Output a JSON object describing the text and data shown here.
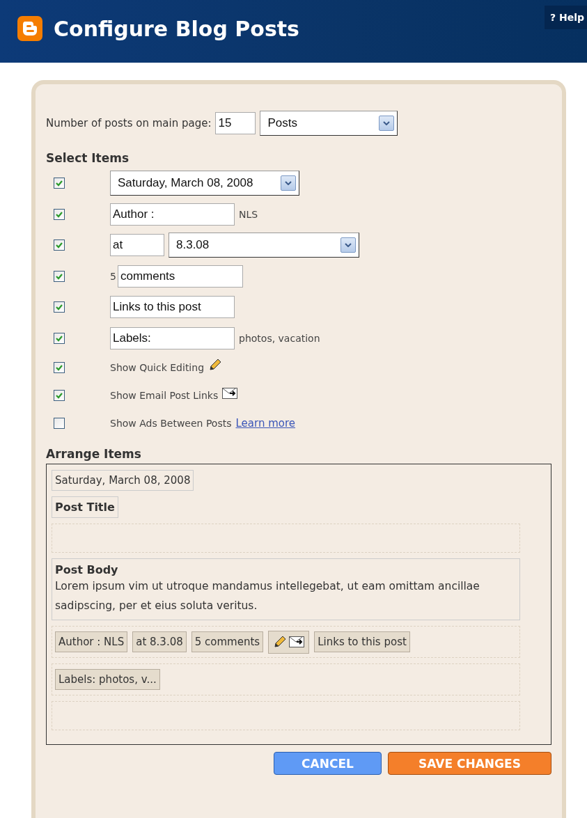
{
  "header": {
    "title": "Configure Blog Posts",
    "help": "? Help"
  },
  "posts_count": {
    "label": "Number of posts on main page:",
    "value": "15",
    "unit": "Posts"
  },
  "select_items": {
    "heading": "Select Items",
    "items": [
      {
        "kind": "dropdown",
        "checked": true,
        "value": "Saturday, March 08, 2008"
      },
      {
        "kind": "field",
        "checked": true,
        "value": "Author :",
        "suffix": "NLS"
      },
      {
        "kind": "field_dropdown",
        "checked": true,
        "value": "at",
        "dropdown": "8.3.08"
      },
      {
        "kind": "prefix_field",
        "checked": true,
        "prefix": "5",
        "value": "comments"
      },
      {
        "kind": "field",
        "checked": true,
        "value": "Links to this post"
      },
      {
        "kind": "field",
        "checked": true,
        "value": "Labels:",
        "suffix": "photos, vacation"
      },
      {
        "kind": "pencil",
        "checked": true,
        "label": "Show Quick Editing"
      },
      {
        "kind": "mail",
        "checked": true,
        "label": "Show Email Post Links"
      },
      {
        "kind": "link",
        "checked": false,
        "label": "Show Ads Between Posts",
        "link": "Learn more"
      }
    ]
  },
  "arrange_items": {
    "heading": "Arrange Items",
    "rows": [
      {
        "kind": "chip",
        "text": "Saturday, March 08, 2008"
      },
      {
        "kind": "title",
        "text": "Post Title"
      },
      {
        "kind": "slot"
      },
      {
        "kind": "body",
        "title": "Post Body",
        "text": "Lorem ipsum vim ut utroque mandamus intellegebat, ut eam omittam ancillae sadipscing, per et eius soluta veritus."
      },
      {
        "kind": "chips",
        "chips": [
          {
            "kind": "text",
            "text": "Author : NLS"
          },
          {
            "kind": "text",
            "text": "at 8.3.08"
          },
          {
            "kind": "text",
            "text": "5 comments"
          },
          {
            "kind": "icons"
          },
          {
            "kind": "text",
            "text": "Links to this post"
          }
        ]
      },
      {
        "kind": "chips",
        "chips": [
          {
            "kind": "text",
            "text": "Labels: photos, v..."
          }
        ]
      },
      {
        "kind": "slot"
      }
    ]
  },
  "buttons": {
    "cancel": "CANCEL",
    "save": "SAVE CHANGES"
  }
}
